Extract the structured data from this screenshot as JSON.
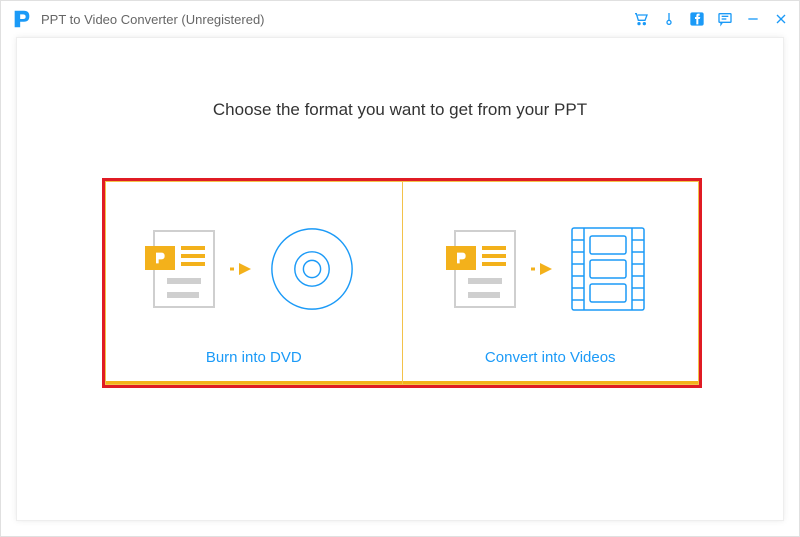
{
  "titlebar": {
    "app_title": "PPT to Video Converter (Unregistered)"
  },
  "main": {
    "heading": "Choose the format you want to get from your PPT",
    "cards": [
      {
        "label": "Burn into DVD"
      },
      {
        "label": "Convert into Videos"
      }
    ]
  },
  "colors": {
    "accent_blue": "#1b9af7",
    "accent_yellow": "#f3b11b",
    "highlight_red": "#e01b24"
  }
}
